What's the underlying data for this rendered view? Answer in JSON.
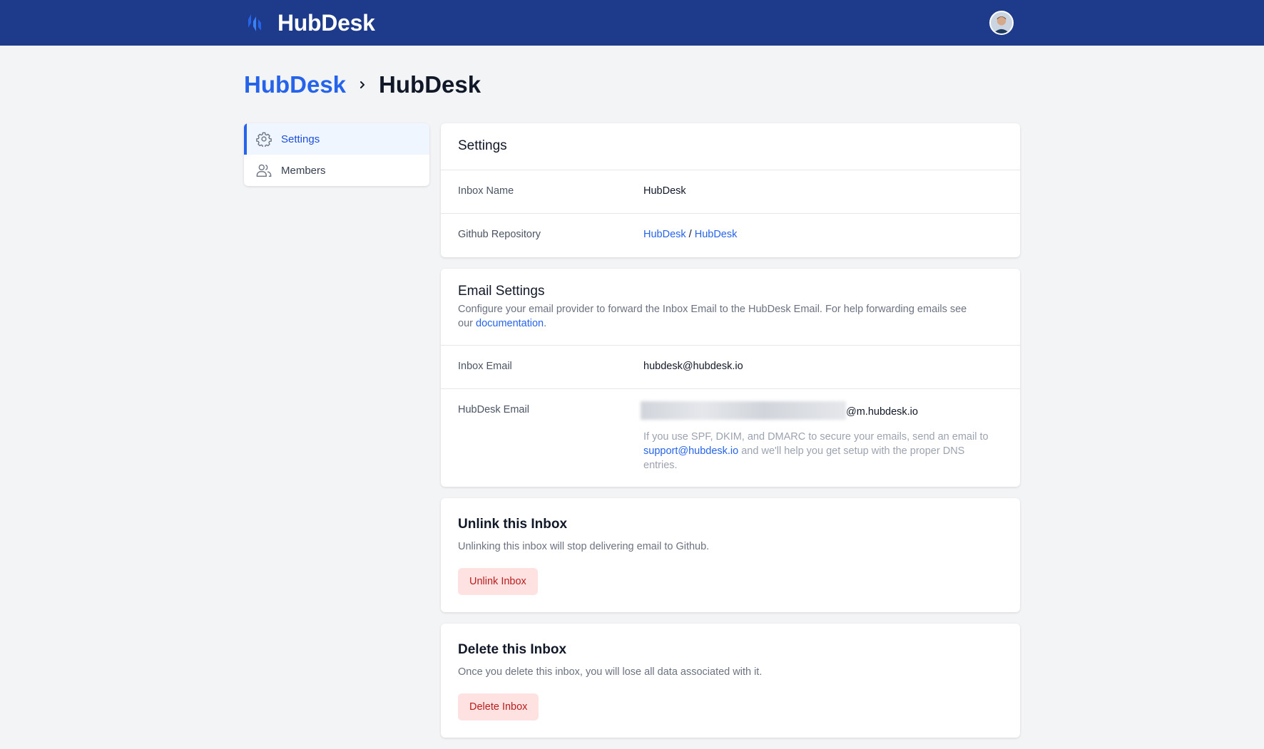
{
  "app": {
    "name": "HubDesk"
  },
  "breadcrumb": {
    "parent": "HubDesk",
    "current": "HubDesk"
  },
  "sidebar": {
    "items": [
      {
        "label": "Settings",
        "icon": "gear-icon",
        "active": true
      },
      {
        "label": "Members",
        "icon": "users-icon",
        "active": false
      }
    ]
  },
  "settings": {
    "title": "Settings",
    "rows": [
      {
        "label": "Inbox Name",
        "value": "HubDesk"
      },
      {
        "label": "Github Repository",
        "owner": "HubDesk",
        "separator": "/",
        "repo": "HubDesk"
      }
    ]
  },
  "email_settings": {
    "title": "Email Settings",
    "description_prefix": "Configure your email provider to forward the Inbox Email to the HubDesk Email. For help forwarding emails see our ",
    "description_link": "documentation",
    "description_suffix": ".",
    "inbox_email_label": "Inbox Email",
    "inbox_email_value": "hubdesk@hubdesk.io",
    "hubdesk_email_label": "HubDesk Email",
    "hubdesk_email_domain": "@m.hubdesk.io",
    "help_prefix": "If you use SPF, DKIM, and DMARC to secure your emails, send an email to ",
    "help_link": "support@hubdesk.io",
    "help_suffix": " and we'll help you get setup with the proper DNS entries."
  },
  "unlink": {
    "title": "Unlink this Inbox",
    "description": "Unlinking this inbox will stop delivering email to Github.",
    "button": "Unlink Inbox"
  },
  "delete": {
    "title": "Delete this Inbox",
    "description": "Once you delete this inbox, you will lose all data associated with it.",
    "button": "Delete Inbox"
  },
  "colors": {
    "topbar": "#1e3a8a",
    "accent": "#2563eb",
    "danger_bg": "#fee2e2",
    "danger_text": "#b91c1c",
    "background": "#f3f4f6"
  }
}
